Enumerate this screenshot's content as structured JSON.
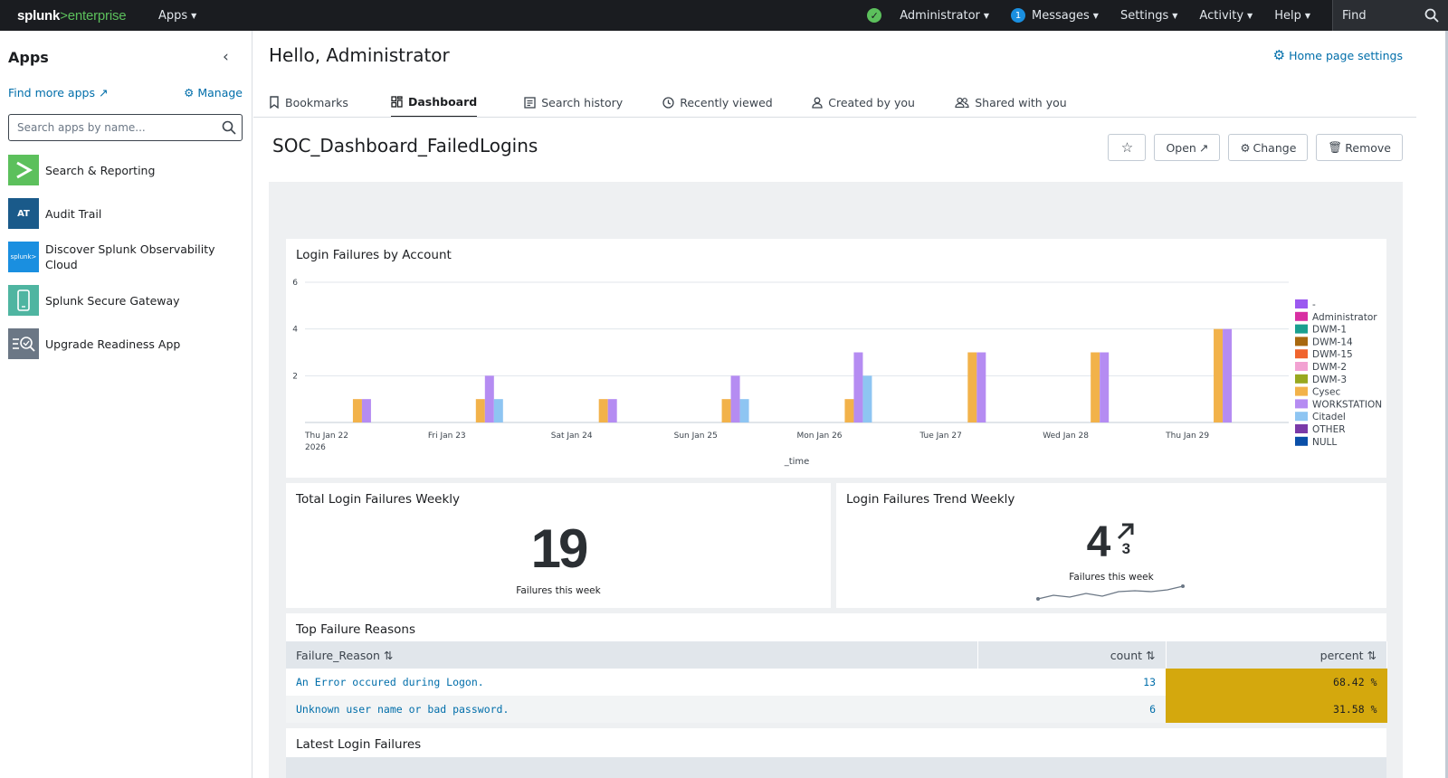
{
  "topbar": {
    "logo_main": "splunk",
    "logo_sep": ">",
    "logo_product": "enterprise",
    "apps_label": "Apps",
    "user_label": "Administrator",
    "messages_count": "1",
    "messages_label": "Messages",
    "settings_label": "Settings",
    "activity_label": "Activity",
    "help_label": "Help",
    "find_label": "Find"
  },
  "sidebar": {
    "title": "Apps",
    "find_more": "Find more apps",
    "manage": "Manage",
    "search_placeholder": "Search apps by name...",
    "apps": [
      {
        "label": "Search & Reporting",
        "icon": "search-reporting-icon",
        "color": "#5cc05c",
        "glyph": ">"
      },
      {
        "label": "Audit Trail",
        "icon": "audit-trail-icon",
        "color": "#1a5a8a",
        "glyph": "AT"
      },
      {
        "label": "Discover Splunk Observability Cloud",
        "icon": "splunk-observability-icon",
        "color": "#1a8fe0",
        "glyph": "splunk>"
      },
      {
        "label": "Splunk Secure Gateway",
        "icon": "mobile-device-icon",
        "color": "#4fb5a1",
        "glyph": ""
      },
      {
        "label": "Upgrade Readiness App",
        "icon": "upgrade-readiness-icon",
        "color": "#6b7785",
        "glyph": ""
      }
    ]
  },
  "main": {
    "greeting": "Hello, Administrator",
    "home_settings": "Home page settings",
    "tabs": [
      {
        "label": "Bookmarks",
        "icon": "bookmark-icon"
      },
      {
        "label": "Dashboard",
        "icon": "dashboard-icon"
      },
      {
        "label": "Search history",
        "icon": "search-history-icon"
      },
      {
        "label": "Recently viewed",
        "icon": "clock-icon"
      },
      {
        "label": "Created by you",
        "icon": "user-icon"
      },
      {
        "label": "Shared with you",
        "icon": "users-icon"
      }
    ],
    "active_tab": "Dashboard",
    "dashboard_title": "SOC_Dashboard_FailedLogins",
    "buttons": {
      "star": "☆",
      "open": "Open",
      "change": "Change",
      "remove": "Remove"
    }
  },
  "panels": {
    "chart_title": "Login Failures by Account",
    "total_title": "Total Login Failures Weekly",
    "total_value": "19",
    "total_caption": "Failures this week",
    "trend_title": "Login Failures Trend Weekly",
    "trend_value": "4",
    "trend_delta": "3",
    "trend_caption": "Failures this week",
    "reasons_title": "Top Failure Reasons",
    "latest_title": "Latest Login Failures"
  },
  "reasons_table": {
    "columns": [
      "Failure_Reason",
      "count",
      "percent"
    ],
    "rows": [
      {
        "reason": "An Error occured during Logon.",
        "count": "13",
        "percent": "68.42 %"
      },
      {
        "reason": "Unknown user name or bad password.",
        "count": "6",
        "percent": "31.58 %"
      }
    ]
  },
  "chart_data": {
    "type": "bar",
    "title": "Login Failures by Account",
    "xlabel": "_time",
    "ylabel": "",
    "ylim": [
      0,
      6
    ],
    "yticks": [
      2,
      4,
      6
    ],
    "grid": true,
    "legend_position": "right",
    "x_ticks": [
      {
        "label": "Thu Jan 22",
        "sub": "2026"
      },
      {
        "label": "Fri Jan 23",
        "sub": ""
      },
      {
        "label": "Sat Jan 24",
        "sub": ""
      },
      {
        "label": "Sun Jan 25",
        "sub": ""
      },
      {
        "label": "Mon Jan 26",
        "sub": ""
      },
      {
        "label": "Tue Jan 27",
        "sub": ""
      },
      {
        "label": "Wed Jan 28",
        "sub": ""
      },
      {
        "label": "Thu Jan 29",
        "sub": ""
      }
    ],
    "legend": [
      {
        "name": "-",
        "color": "#9b59f0"
      },
      {
        "name": "Administrator",
        "color": "#d82fa2"
      },
      {
        "name": "DWM-1",
        "color": "#1a9f8f"
      },
      {
        "name": "DWM-14",
        "color": "#a8680f"
      },
      {
        "name": "DWM-15",
        "color": "#f0642e"
      },
      {
        "name": "DWM-2",
        "color": "#f2a2d2"
      },
      {
        "name": "DWM-3",
        "color": "#98a81f"
      },
      {
        "name": "Cysec",
        "color": "#f2b24a"
      },
      {
        "name": "WORKSTATION",
        "color": "#b58cf2"
      },
      {
        "name": "Citadel",
        "color": "#8ec5f2"
      },
      {
        "name": "OTHER",
        "color": "#7a3aa8"
      },
      {
        "name": "NULL",
        "color": "#0a4fa8"
      }
    ],
    "categories": [
      "Thu Jan 22 12:00",
      "Fri Jan 23 12:00",
      "Sat Jan 24 12:00",
      "Sun Jan 25 12:00",
      "Mon Jan 26 12:00",
      "Tue Jan 27 12:00",
      "Wed Jan 28 12:00",
      "Thu Jan 29 12:00"
    ],
    "series": [
      {
        "name": "Cysec",
        "color": "#f2b24a",
        "values": [
          1,
          1,
          1,
          1,
          1,
          3,
          3,
          4
        ]
      },
      {
        "name": "WORKSTATION",
        "color": "#b58cf2",
        "values": [
          1,
          2,
          1,
          2,
          3,
          3,
          3,
          4
        ]
      },
      {
        "name": "Citadel",
        "color": "#8ec5f2",
        "values": [
          0,
          1,
          0,
          1,
          2,
          0,
          0,
          0
        ]
      }
    ]
  },
  "colors": {
    "accent": "#006eaa",
    "topbar_bg": "#1a1c20",
    "percent_fill": "#d4a80d"
  }
}
